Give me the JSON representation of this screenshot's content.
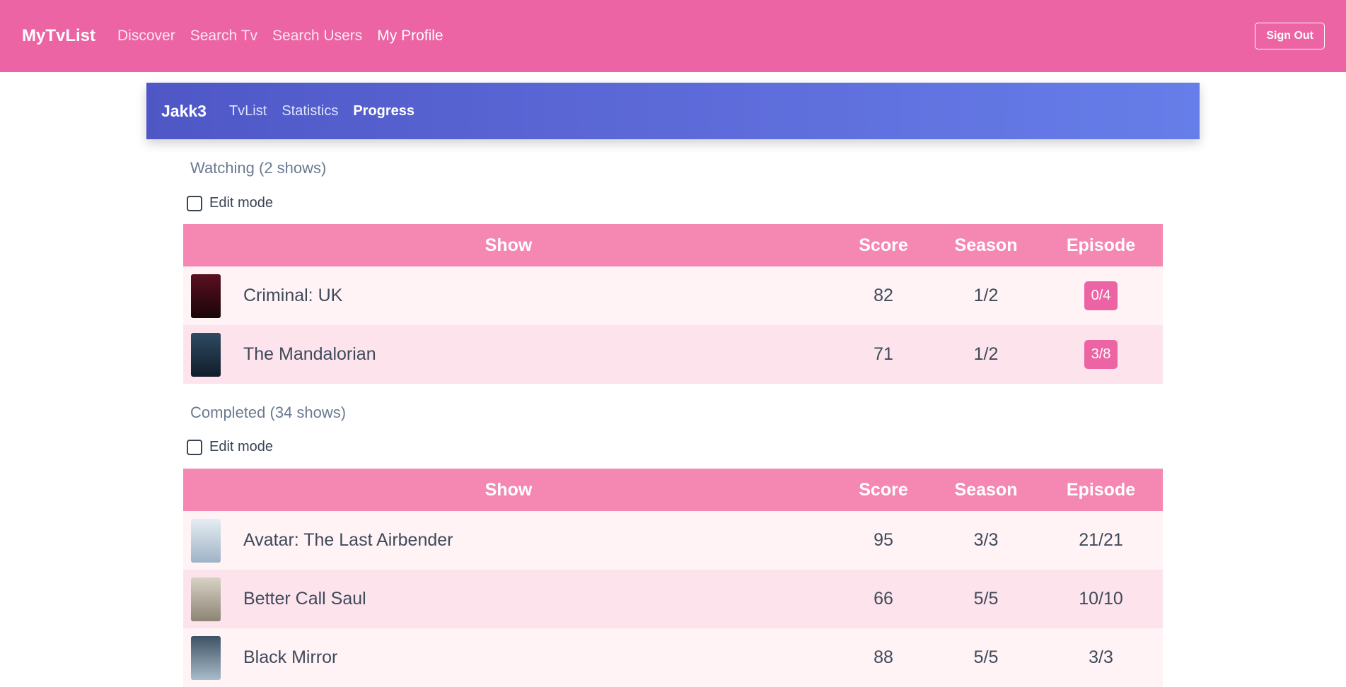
{
  "nav": {
    "brand": "MyTvList",
    "links": [
      "Discover",
      "Search Tv",
      "Search Users",
      "My Profile"
    ],
    "sign_out": "Sign Out"
  },
  "profile": {
    "username": "Jakk3",
    "tabs": [
      "TvList",
      "Statistics",
      "Progress"
    ]
  },
  "watching": {
    "title": "Watching (2 shows)",
    "edit_mode": "Edit mode",
    "headers": [
      "Show",
      "Score",
      "Season",
      "Episode"
    ],
    "rows": [
      {
        "name": "Criminal: UK",
        "score": "82",
        "season": "1/2",
        "episode": "0/4",
        "poster_color": "#3a0f1a"
      },
      {
        "name": "The Mandalorian",
        "score": "71",
        "season": "1/2",
        "episode": "3/8",
        "poster_color": "#1f3a4f"
      }
    ]
  },
  "completed": {
    "title": "Completed (34 shows)",
    "edit_mode": "Edit mode",
    "headers": [
      "Show",
      "Score",
      "Season",
      "Episode"
    ],
    "rows": [
      {
        "name": "Avatar: The Last Airbender",
        "score": "95",
        "season": "3/3",
        "episode": "21/21",
        "poster_color": "#c9d6e2"
      },
      {
        "name": "Better Call Saul",
        "score": "66",
        "season": "5/5",
        "episode": "10/10",
        "poster_color": "#b7b2a8"
      },
      {
        "name": "Black Mirror",
        "score": "88",
        "season": "5/5",
        "episode": "3/3",
        "poster_color": "#7d95a8"
      }
    ]
  }
}
